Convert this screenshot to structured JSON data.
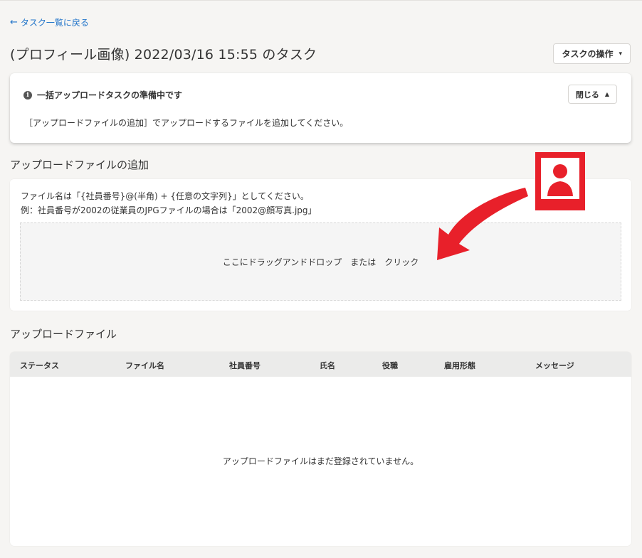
{
  "nav": {
    "back_label": "タスク一覧に戻る",
    "back_arrow": "←"
  },
  "header": {
    "title": "(プロフィール画像) 2022/03/16 15:55 のタスク",
    "task_ops_label": "タスクの操作",
    "caret_down": "▾"
  },
  "notice": {
    "icon_char": "i",
    "title": "一括アップロードタスクの準備中です",
    "close_label": "閉じる",
    "caret_up": "▲",
    "body": "［アップロードファイルの追加］でアップロードするファイルを追加してください。"
  },
  "upload": {
    "section_title": "アップロードファイルの追加",
    "hint_line1": "ファイル名は「{社員番号}@(半角) + {任意の文字列}」としてください。",
    "hint_line2": "例：社員番号が2002の従業員のJPGファイルの場合は「2002@顔写真.jpg」",
    "dropzone_label": "ここにドラッグアンドドロップ　または　クリック"
  },
  "files": {
    "section_title": "アップロードファイル",
    "columns": [
      "ステータス",
      "ファイル名",
      "社員番号",
      "氏名",
      "役職",
      "雇用形態",
      "メッセージ"
    ],
    "empty_message": "アップロードファイルはまだ登録されていません。"
  },
  "colors": {
    "link": "#1f73c9",
    "annotation_red": "#e8202a",
    "background": "#f6f5f3"
  },
  "icons": {
    "annotation": "person-silhouette-icon"
  }
}
